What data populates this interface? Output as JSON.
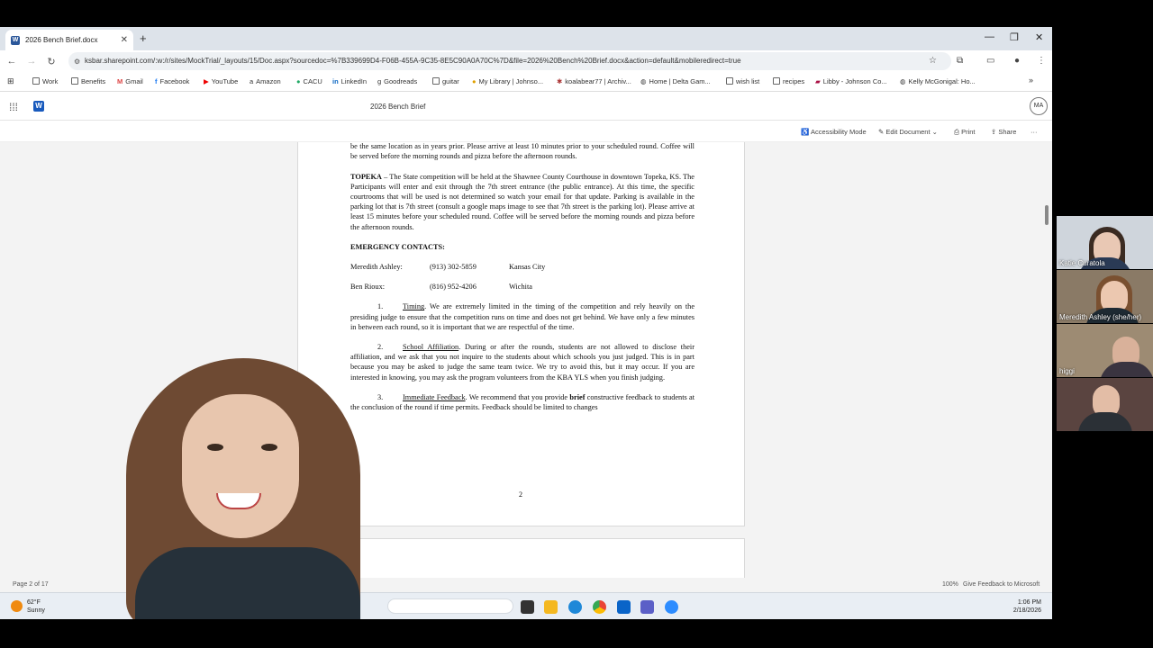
{
  "browser": {
    "tab_title": "2026 Bench Brief.docx",
    "new_tab": "+",
    "url": "ksbar.sharepoint.com/:w:/r/sites/MockTrial/_layouts/15/Doc.aspx?sourcedoc=%7B339699D4-F06B-455A-9C35-8E5C90A0A70C%7D&file=2026%20Bench%20Brief.docx&action=default&mobileredirect=true",
    "bookmarks": [
      "Work",
      "Benefits",
      "Gmail",
      "Facebook",
      "YouTube",
      "Amazon",
      "CACU",
      "LinkedIn",
      "Goodreads",
      "guitar",
      "My Library | Johnso...",
      "koalabear77 | Archiv...",
      "Home | Delta Gam...",
      "wish list",
      "recipes",
      "Libby - Johnson Co...",
      "Kelly McGonigal: Ho..."
    ],
    "bookmarks_more": "»"
  },
  "word": {
    "doc_title": "2026 Bench Brief",
    "avatar_initials": "MA",
    "commands": {
      "accessibility": "Accessibility Mode",
      "edit": "Edit Document",
      "print": "Print",
      "share": "Share",
      "more": "···"
    }
  },
  "doc": {
    "cut_para": "main floor.  Parking is available in the garage just north of the courthouse.  If you have judged in the past, this will be the same location as in years prior.  Please arrive at least 10 minutes prior to your scheduled round.  Coffee will be served before the morning rounds and pizza before the afternoon rounds.",
    "topeka_label": "TOPEKA",
    "topeka_text": " – The State competition will be held at the Shawnee County Courthouse in downtown Topeka, KS.  The Participants will enter and exit through the 7th street entrance (the public entrance).  At this time, the specific courtrooms that will be used is not determined so watch your email for that update.  Parking is available in the parking lot that is 7th street (consult a google maps image to see that 7th street is the parking lot).  Please arrive at least 15 minutes before your scheduled round. Coffee will be served before the morning rounds and pizza before the afternoon rounds.",
    "emergency_heading": "EMERGENCY CONTACTS:",
    "contacts": [
      {
        "name": "Meredith Ashley:",
        "phone": "(913) 302-5859",
        "city": "Kansas City"
      },
      {
        "name": "Ben Rioux:",
        "phone": "(816) 952-4206",
        "city": "Wichita"
      }
    ],
    "items": [
      {
        "num": "1.",
        "title": "Timing",
        "text": ".  We are extremely limited in the timing of the competition and rely heavily on the presiding judge to ensure that the competition runs on time and does not get behind.  We have only a few minutes in between each round, so it is important that we are respectful of the time."
      },
      {
        "num": "2.",
        "title": "School Affiliation",
        "text": ".  During or after the rounds, students are not allowed to disclose their affiliation, and we ask that you not inquire to the students about which schools you just judged.  This is in part because you may be asked to judge the same team twice.  We try to avoid this, but it may occur.  If you are interested in knowing, you may ask the program volunteers from the KBA YLS when you finish judging."
      },
      {
        "num": "3.",
        "title": "Immediate Feedback",
        "text_pre": ".  We recommend that you provide ",
        "bold": "brief",
        "text_post": " constructive feedback to students at the conclusion of the round if time permits.  Feedback should be limited to changes"
      }
    ],
    "page_number": "2"
  },
  "status": {
    "page": "Page 2 of 17",
    "zoom": "100%",
    "feedback": "Give Feedback to Microsoft"
  },
  "taskbar": {
    "temp": "62°F",
    "condition": "Sunny",
    "time": "1:06 PM",
    "date": "2/18/2026"
  },
  "participants": [
    {
      "name": "Katie Curatola"
    },
    {
      "name": "Meredith Ashley (she/her)"
    },
    {
      "name": "higgi"
    },
    {
      "name": ""
    }
  ]
}
